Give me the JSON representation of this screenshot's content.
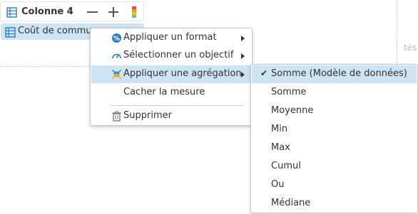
{
  "background": {
    "text": "tés"
  },
  "column": {
    "title": "Colonne 4",
    "measure_label": "Coût de commun",
    "icons": [
      "grid-icon",
      "minus-icon",
      "plus-icon",
      "color-scale-icon"
    ],
    "color_scale": [
      "#e84c3d",
      "#f39c12",
      "#f1c40f",
      "#7cc576"
    ]
  },
  "context_menu": {
    "items": [
      {
        "label": "Appliquer un format",
        "icon": "format-icon",
        "has_submenu": true
      },
      {
        "label": "Sélectionner un objectif",
        "icon": "gauge-icon",
        "has_submenu": true
      },
      {
        "label": "Appliquer une agrégation",
        "icon": "aggregation-icon",
        "has_submenu": true,
        "highlighted": true
      },
      {
        "label": "Cacher la mesure",
        "has_submenu": false
      },
      {
        "label": "Supprimer",
        "icon": "trash-icon",
        "has_submenu": false
      }
    ]
  },
  "aggregation_menu": {
    "selected": "Somme (Modèle de données)",
    "items": [
      "Somme (Modèle de données)",
      "Somme",
      "Moyenne",
      "Min",
      "Max",
      "Cumul",
      "Ou",
      "Médiane"
    ]
  },
  "colors": {
    "highlight": "#cde4f5",
    "accent_blue": "#2a7fc1"
  }
}
